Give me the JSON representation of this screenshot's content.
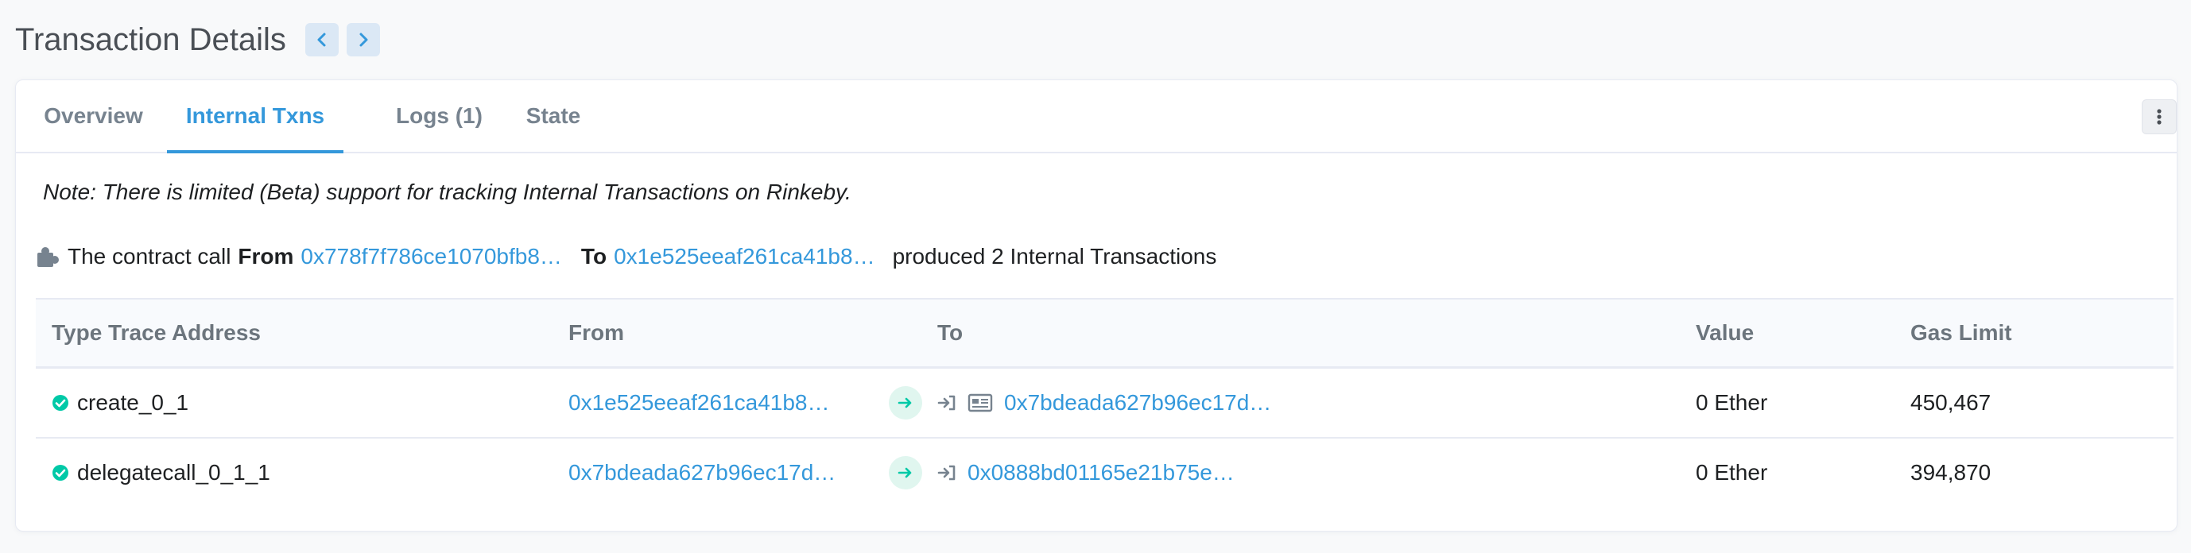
{
  "header": {
    "title": "Transaction Details",
    "prev_icon": "chevron-left-icon",
    "next_icon": "chevron-right-icon"
  },
  "tabs": [
    {
      "label": "Overview",
      "active": false
    },
    {
      "label": "Internal Txns",
      "active": true
    },
    {
      "label": "Logs (1)",
      "active": false
    },
    {
      "label": "State",
      "active": false
    }
  ],
  "note": "Note: There is limited (Beta) support for tracking Internal Transactions on Rinkeby.",
  "summary": {
    "icon": "puzzle-piece-icon",
    "prefix": "The contract call",
    "from_label": "From",
    "from_address": "0x778f7f786ce1070bfb8…",
    "to_label": "To",
    "to_address": "0x1e525eeaf261ca41b8…",
    "suffix": "produced 2 Internal Transactions"
  },
  "table": {
    "columns": [
      "Type Trace Address",
      "From",
      "To",
      "Value",
      "Gas Limit"
    ],
    "rows": [
      {
        "type": "create_0_1",
        "from": "0x1e525eeaf261ca41b8…",
        "to": "0x7bdeada627b96ec17d…",
        "to_is_contract": true,
        "value": "0 Ether",
        "gas_limit": "450,467"
      },
      {
        "type": "delegatecall_0_1_1",
        "from": "0x7bdeada627b96ec17d…",
        "to": "0x0888bd01165e21b75e…",
        "to_is_contract": false,
        "value": "0 Ether",
        "gas_limit": "394,870"
      }
    ]
  },
  "colors": {
    "link": "#3498db",
    "success": "#00c9a7",
    "muted": "#77838f"
  }
}
